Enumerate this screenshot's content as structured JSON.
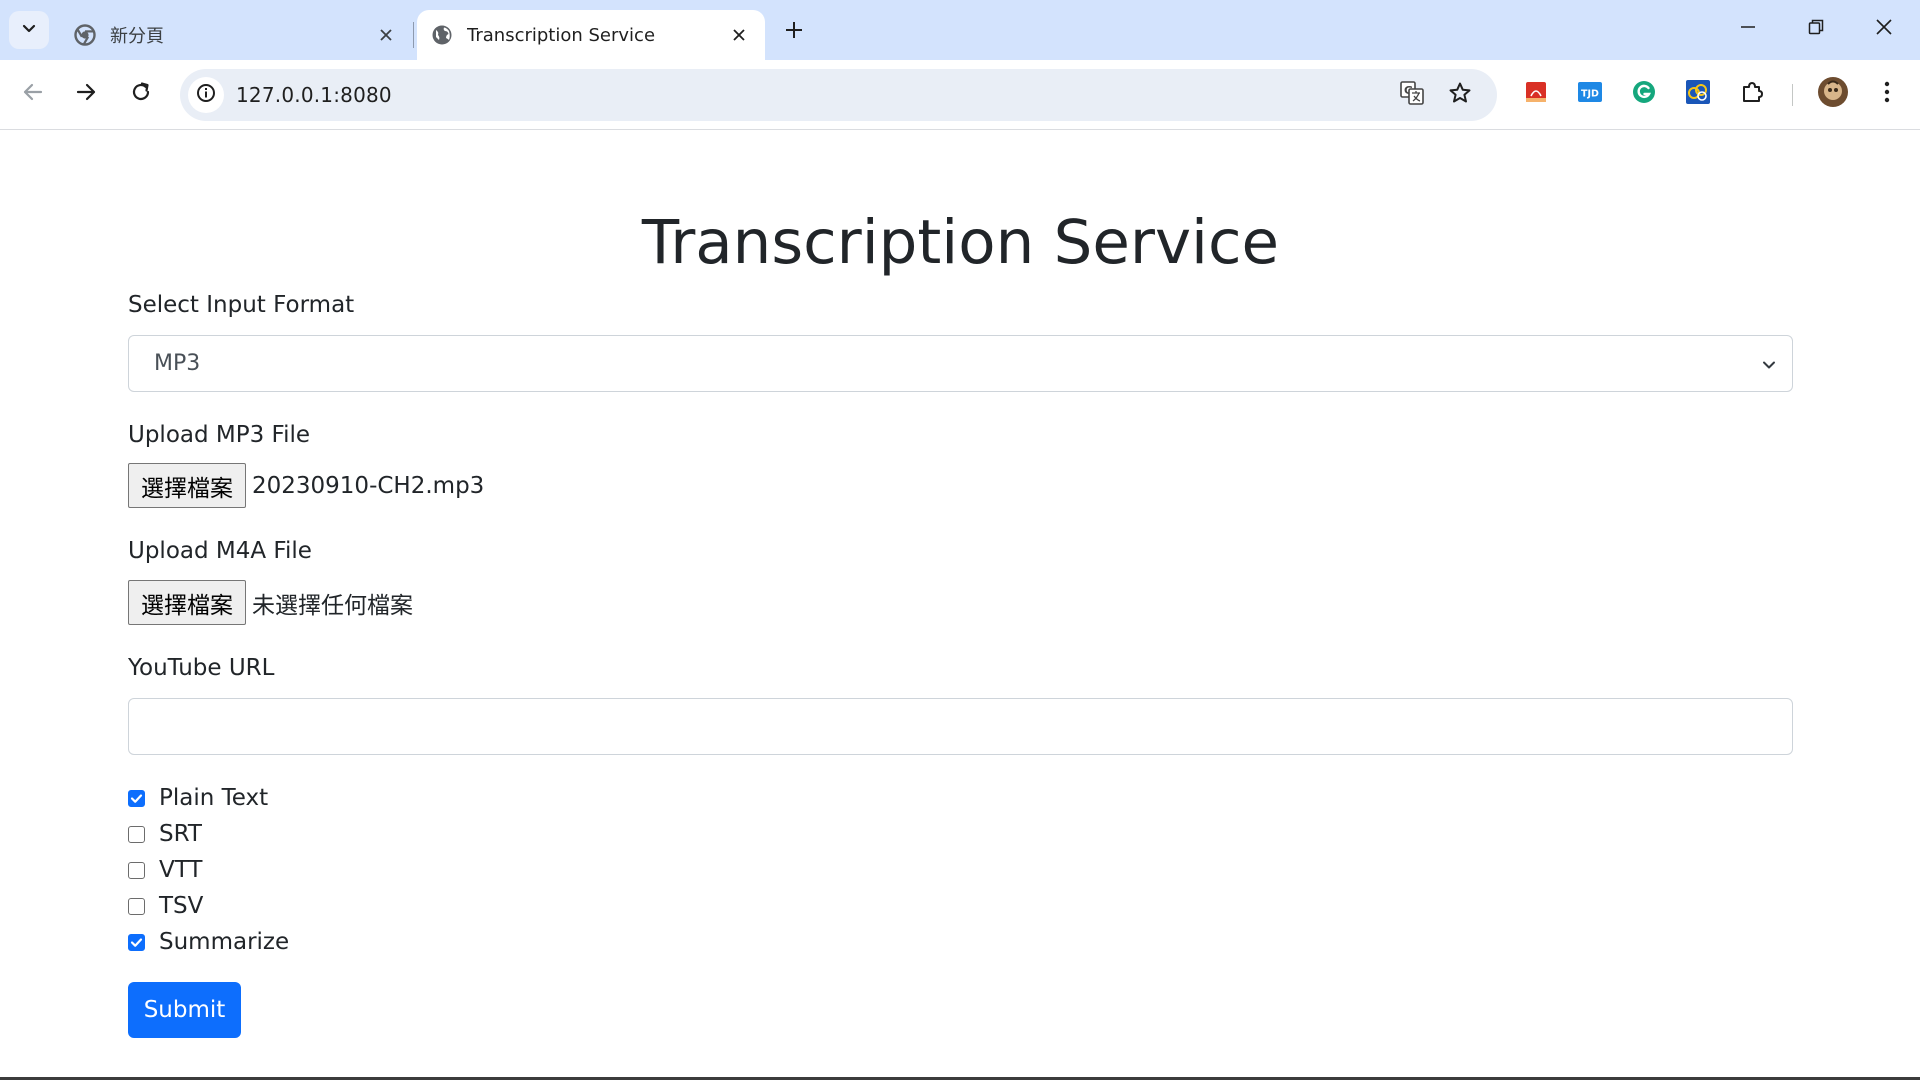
{
  "browser": {
    "tabs": [
      {
        "title": "新分頁",
        "icon": "chrome-icon",
        "active": false
      },
      {
        "title": "Transcription Service",
        "icon": "globe-icon",
        "active": true
      }
    ],
    "url": "127.0.0.1:8080",
    "window_controls": [
      "minimize-icon",
      "restore-icon",
      "close-icon"
    ],
    "extensions": [
      "acrobat-extension-icon",
      "tjd-extension-icon",
      "grammarly-extension-icon",
      "cloud-extension-icon",
      "puzzle-icon"
    ],
    "ext_tjd_label": "TJD",
    "accent": "#d3e3fd"
  },
  "page": {
    "title": "Transcription Service",
    "select_label": "Select Input Format",
    "select_value": "MP3",
    "mp3_label": "Upload MP3 File",
    "mp3_button": "選擇檔案",
    "mp3_file": "20230910-CH2.mp3",
    "m4a_label": "Upload M4A File",
    "m4a_button": "選擇檔案",
    "m4a_file": "未選擇任何檔案",
    "youtube_label": "YouTube URL",
    "youtube_value": "",
    "options": [
      {
        "label": "Plain Text",
        "checked": true
      },
      {
        "label": "SRT",
        "checked": false
      },
      {
        "label": "VTT",
        "checked": false
      },
      {
        "label": "TSV",
        "checked": false
      },
      {
        "label": "Summarize",
        "checked": true
      }
    ],
    "submit_label": "Submit",
    "primary_color": "#0d6efd"
  }
}
